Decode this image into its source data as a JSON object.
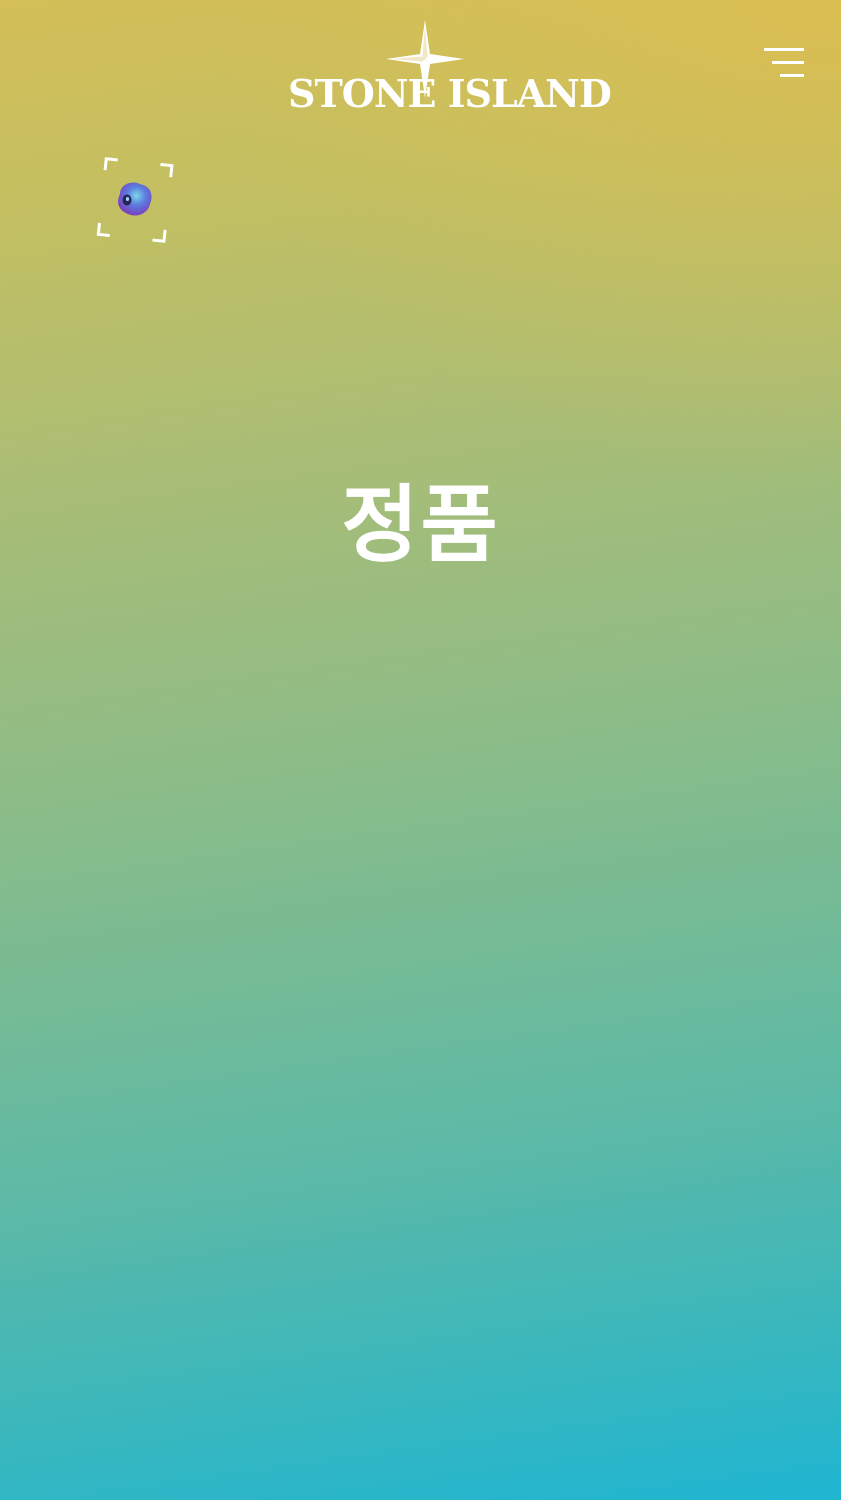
{
  "header": {
    "brand": "STONE ISLAND",
    "logo_icon": "compass-rose-icon",
    "menu_icon": "hamburger-menu-icon"
  },
  "scan": {
    "icon": "scan-camera-icon"
  },
  "main": {
    "title": "정품"
  },
  "colors": {
    "gradient_top": "#d4bf58",
    "gradient_middle": "#8fbc86",
    "gradient_bottom": "#1fb6d2",
    "foreground": "#ffffff"
  }
}
